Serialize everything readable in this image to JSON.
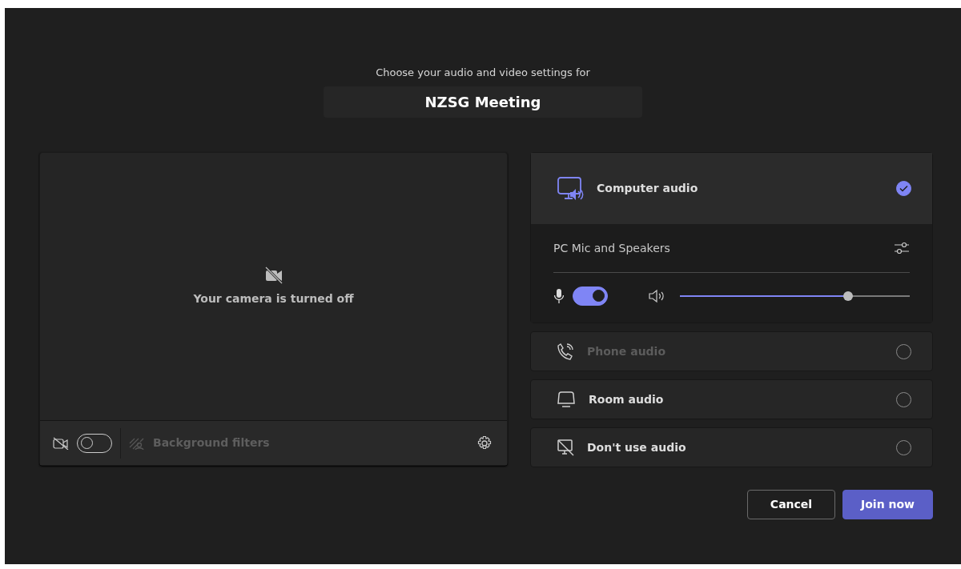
{
  "header": {
    "subtitle": "Choose your audio and video settings for",
    "meeting_title": "NZSG Meeting"
  },
  "video": {
    "status": "Your camera is turned off",
    "camera_on": false,
    "background_filters": {
      "label": "Background filters",
      "disabled": true
    }
  },
  "audio_options": [
    {
      "kind": "computer",
      "label": "Computer audio",
      "selected": true,
      "disabled": false,
      "device": "PC Mic and Speakers",
      "mic_on": true,
      "volume": {
        "level": 0.73
      }
    },
    {
      "kind": "phone",
      "label": "Phone audio",
      "selected": false,
      "disabled": true
    },
    {
      "kind": "room",
      "label": "Room audio",
      "selected": false,
      "disabled": false
    },
    {
      "kind": "none",
      "label": "Don't use audio",
      "selected": false,
      "disabled": false
    }
  ],
  "buttons": [
    {
      "label": "Cancel",
      "kind": "secondary"
    },
    {
      "label": "Join now",
      "kind": "primary"
    }
  ]
}
